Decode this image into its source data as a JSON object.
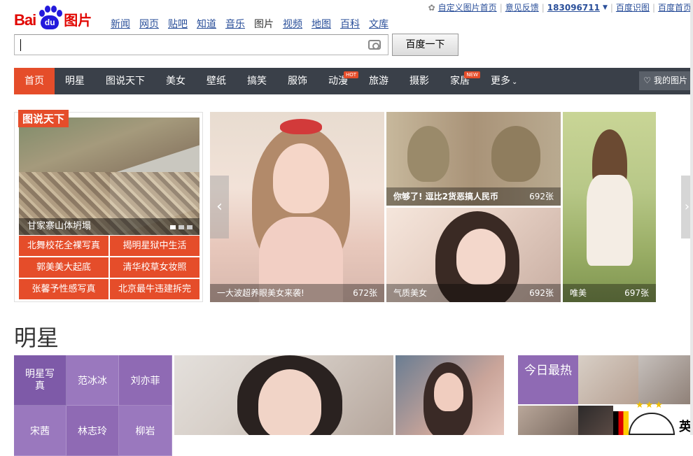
{
  "header": {
    "logo_bai": "Bai",
    "logo_du": "du",
    "logo_tupian": "图片",
    "userbar": {
      "custom": "自定义图片首页",
      "feedback": "意见反馈",
      "user": "183096711",
      "shitu": "百度识图",
      "home": "百度首页"
    }
  },
  "prodnav": [
    "新闻",
    "网页",
    "贴吧",
    "知道",
    "音乐",
    "图片",
    "视频",
    "地图",
    "百科",
    "文库"
  ],
  "search": {
    "value": "",
    "button": "百度一下"
  },
  "mainnav": {
    "items": [
      "首页",
      "明星",
      "图说天下",
      "美女",
      "壁纸",
      "搞笑",
      "服饰",
      "动漫",
      "旅游",
      "摄影",
      "家居",
      "更多"
    ],
    "badges": {
      "hot": "HOT",
      "new": "NEW"
    },
    "my_pics": "我的图片"
  },
  "feature": {
    "tag": "图说天下",
    "caption": "甘家寨山体坍塌",
    "links": [
      "北舞校花全裸写真",
      "揭明星狱中生活",
      "郭美美大起底",
      "清华校草女妆照",
      "张馨予性感写真",
      "北京最牛违建拆完"
    ]
  },
  "tiles": {
    "main_caption": "一大波超养眼美女来袭!",
    "main_count": "672张",
    "t1_caption": "你够了! 逗比2货恶搞人民币",
    "t1_count": "692张",
    "t2_caption": "气质美女",
    "t2_count": "692张",
    "t3_caption": "唯美",
    "t3_count": "697张"
  },
  "section": {
    "title": "明星",
    "grid": [
      "明星写真",
      "范冰冰",
      "刘亦菲",
      "宋茜",
      "林志玲",
      "柳岩"
    ],
    "hot_label": "今日最热",
    "ying": "英"
  }
}
